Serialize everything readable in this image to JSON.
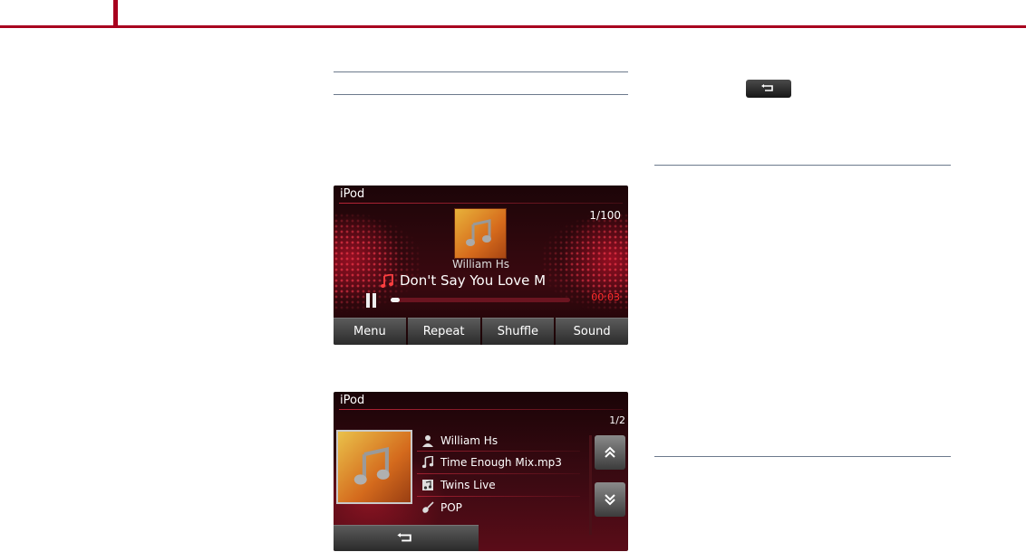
{
  "screen1": {
    "title": "iPod",
    "track_count": "1/100",
    "artist": "William Hs",
    "song": "Don't Say You Love M",
    "elapsed": "00:03",
    "progress_fraction": 0.05,
    "menu": [
      {
        "label": "Menu"
      },
      {
        "label": "Repeat"
      },
      {
        "label": "Shuffle"
      },
      {
        "label": "Sound"
      }
    ]
  },
  "screen2": {
    "title": "iPod",
    "page": "1/2",
    "info": [
      {
        "icon": "artist-icon",
        "text": "William Hs"
      },
      {
        "icon": "music-note-icon",
        "text": "Time Enough Mix.mp3"
      },
      {
        "icon": "album-icon",
        "text": "Twins Live"
      },
      {
        "icon": "guitar-icon",
        "text": "POP"
      }
    ]
  },
  "colors": {
    "accent": "#a8001e",
    "time": "#ff2a2a"
  }
}
